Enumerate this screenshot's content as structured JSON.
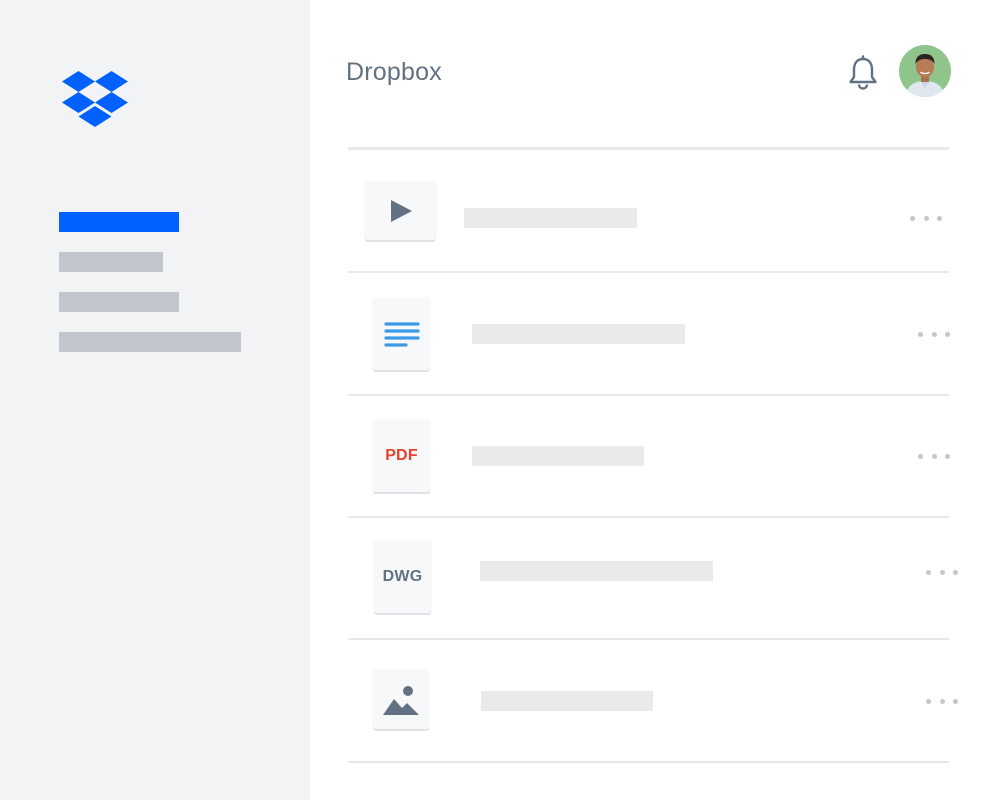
{
  "app": {
    "title": "Dropbox"
  },
  "colors": {
    "brand": "#0061fe",
    "sidebar_bg": "#f2f3f5",
    "nav_placeholder": "#c1c7cd",
    "row_placeholder": "#e9eaec",
    "icon_gray": "#637282",
    "doc_blue": "#3d9ae8",
    "pdf_red": "#e7432a"
  },
  "sidebar": {
    "logo_icon": "dropbox-logo-icon",
    "nav_items": [
      {
        "state": "active"
      },
      {
        "state": "inactive"
      },
      {
        "state": "inactive"
      },
      {
        "state": "inactive"
      }
    ]
  },
  "header": {
    "notification_icon": "bell-icon",
    "avatar_icon": "user-avatar"
  },
  "files": [
    {
      "type": "video",
      "icon": "play-icon"
    },
    {
      "type": "document",
      "icon": "document-lines-icon"
    },
    {
      "type": "pdf",
      "label": "PDF"
    },
    {
      "type": "dwg",
      "label": "DWG"
    },
    {
      "type": "image",
      "icon": "image-icon"
    }
  ]
}
